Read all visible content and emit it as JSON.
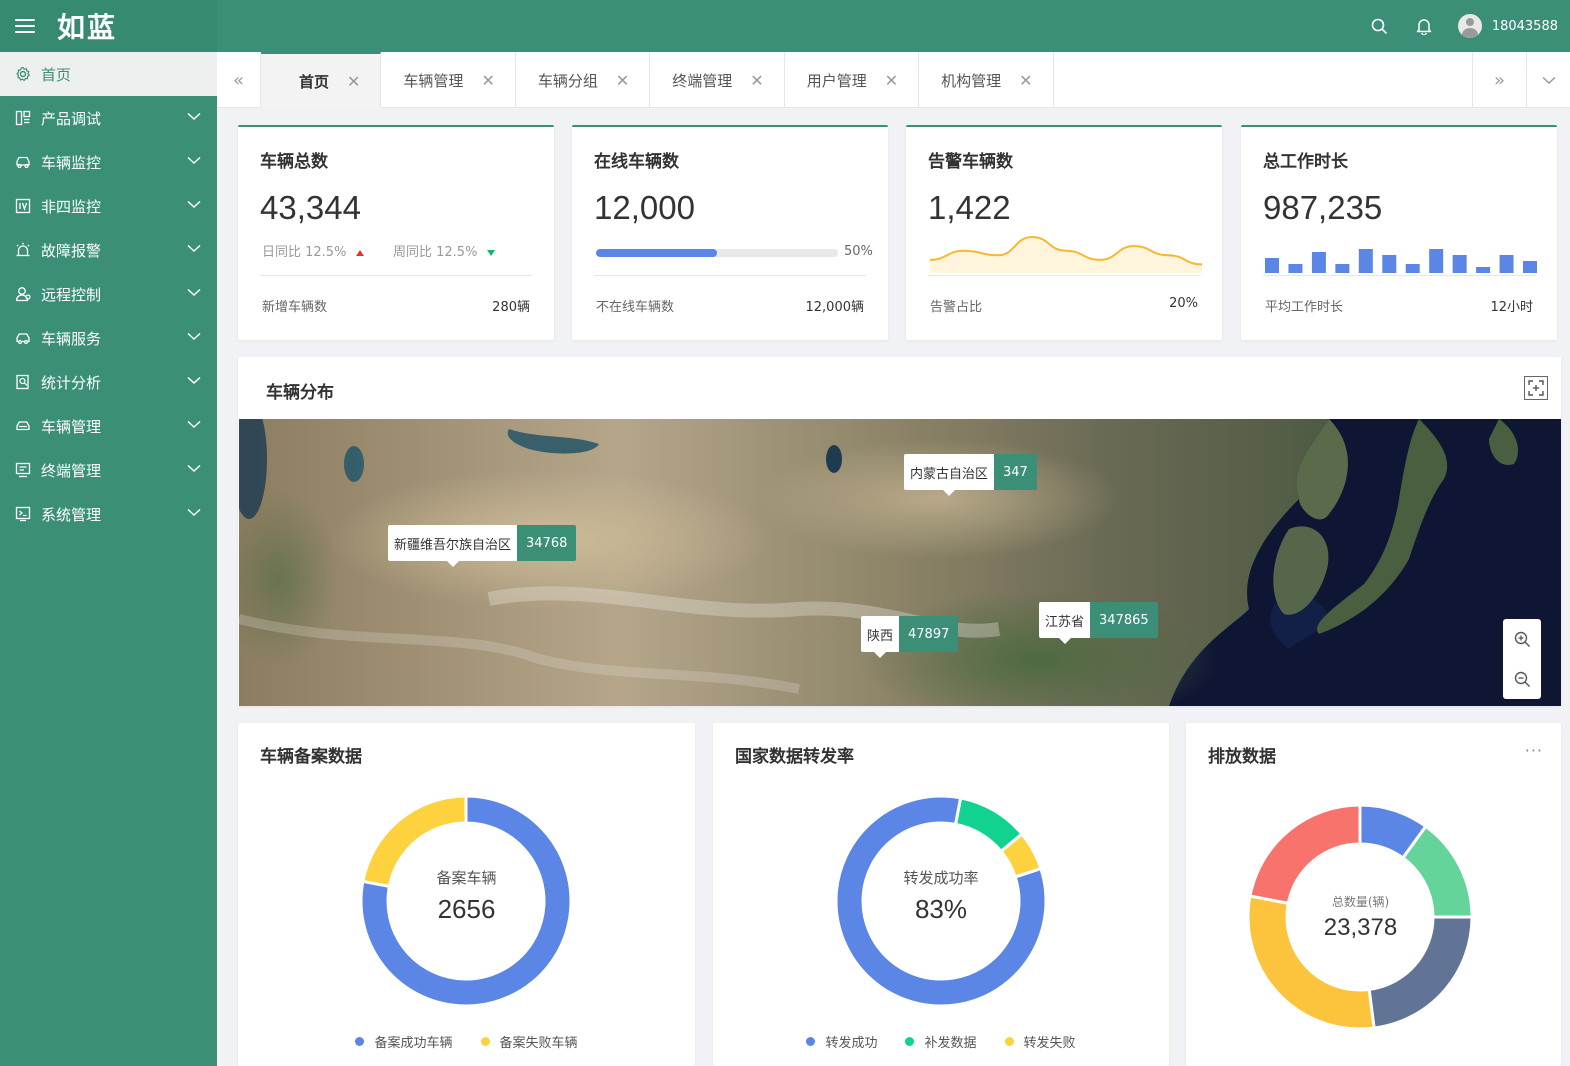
{
  "app": {
    "logo": "如蓝",
    "username": "18043588"
  },
  "colors": {
    "primary": "#3a8f76",
    "blue": "#5b86e5",
    "yellow": "#fdd23e",
    "green": "#11d28f",
    "red": "#f0302b"
  },
  "sidebar": {
    "items": [
      {
        "label": "首页",
        "icon": "home-gear-icon",
        "active": true
      },
      {
        "label": "产品调试",
        "icon": "product-debug-icon"
      },
      {
        "label": "车辆监控",
        "icon": "car-monitor-icon"
      },
      {
        "label": "非四监控",
        "icon": "iv-monitor-icon"
      },
      {
        "label": "故障报警",
        "icon": "alarm-icon"
      },
      {
        "label": "远程控制",
        "icon": "remote-control-icon"
      },
      {
        "label": "车辆服务",
        "icon": "car-service-icon"
      },
      {
        "label": "统计分析",
        "icon": "statistics-icon"
      },
      {
        "label": "车辆管理",
        "icon": "car-manage-icon"
      },
      {
        "label": "终端管理",
        "icon": "terminal-icon"
      },
      {
        "label": "系统管理",
        "icon": "system-icon"
      }
    ]
  },
  "tabs": [
    {
      "label": "首页",
      "active": true
    },
    {
      "label": "车辆管理"
    },
    {
      "label": "车辆分组"
    },
    {
      "label": "终端管理"
    },
    {
      "label": "用户管理"
    },
    {
      "label": "机构管理"
    }
  ],
  "stats": {
    "total": {
      "title": "车辆总数",
      "value": "43,344",
      "day_label": "日同比 12.5%",
      "week_label": "周同比 12.5%",
      "foot_label": "新增车辆数",
      "foot_value": "280辆"
    },
    "online": {
      "title": "在线车辆数",
      "value": "12,000",
      "progress": 50,
      "progress_label": "50%",
      "foot_label": "不在线车辆数",
      "foot_value": "12,000辆"
    },
    "alarm": {
      "title": "告警车辆数",
      "value": "1,422",
      "foot_label": "告警占比",
      "foot_value": "20%"
    },
    "hours": {
      "title": "总工作时长",
      "value": "987,235",
      "foot_label": "平均工作时长",
      "foot_value": "12小时"
    }
  },
  "map": {
    "title": "车辆分布",
    "labels": [
      {
        "name": "内蒙古自治区",
        "value": "347"
      },
      {
        "name": "新疆维吾尔族自治区",
        "value": "34768"
      },
      {
        "name": "陕西",
        "value": "47897"
      },
      {
        "name": "江苏省",
        "value": "347865"
      }
    ]
  },
  "panels": {
    "filing": {
      "title": "车辆备案数据",
      "center_label": "备案车辆",
      "center_value": "2656",
      "legend": [
        "备案成功车辆",
        "备案失败车辆"
      ]
    },
    "forward": {
      "title": "国家数据转发率",
      "center_label": "转发成功率",
      "center_value": "83%",
      "legend": [
        "转发成功",
        "补发数据",
        "转发失败"
      ]
    },
    "emission": {
      "title": "排放数据",
      "center_label": "总数量(辆)",
      "center_value": "23,378",
      "more": "···"
    }
  },
  "chart_data": [
    {
      "type": "area",
      "values": [
        2,
        4,
        3,
        7,
        4,
        2,
        5,
        3,
        1
      ]
    },
    {
      "type": "bar",
      "values": [
        5,
        3,
        7,
        3,
        8,
        6,
        3,
        8,
        6,
        2,
        6,
        4
      ]
    },
    {
      "type": "pie",
      "series": [
        {
          "name": "备案成功车辆",
          "value": 78
        },
        {
          "name": "备案失败车辆",
          "value": 22
        }
      ]
    },
    {
      "type": "pie",
      "series": [
        {
          "name": "转发成功",
          "value": 83
        },
        {
          "name": "补发数据",
          "value": 11
        },
        {
          "name": "转发失败",
          "value": 6
        }
      ]
    },
    {
      "type": "pie",
      "values": [
        10,
        15,
        23,
        30,
        22
      ]
    }
  ]
}
